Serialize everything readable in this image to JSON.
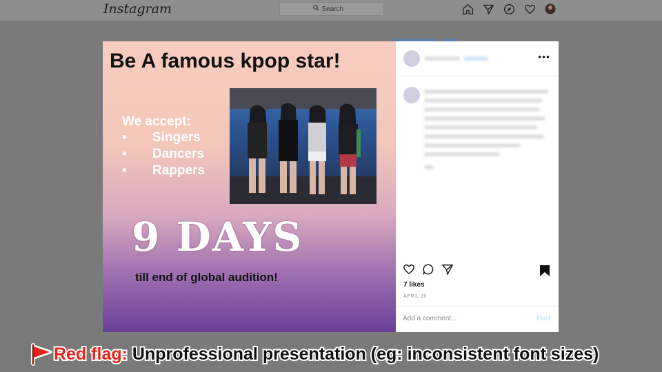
{
  "app": {
    "logo": "Instagram"
  },
  "search": {
    "placeholder": "Search",
    "icon": "search-icon"
  },
  "nav": {
    "icons": [
      "home-icon",
      "direct-icon",
      "explore-icon",
      "heart-icon",
      "profile-avatar"
    ]
  },
  "post": {
    "title": "Be A famous kpop star!",
    "accept_heading": "We accept:",
    "accept_items": [
      "Singers",
      "Dancers",
      "Rappers"
    ],
    "bullet": "•",
    "days": "9 DAYS",
    "until": "till end of global  audition!"
  },
  "sidebar": {
    "more": "•••",
    "likes": "7 likes",
    "date": "APRIL 26",
    "comment_placeholder": "Add a comment...",
    "post_label": "Post"
  },
  "caption": {
    "flag_label": "Red flag:",
    "message": "Unprofessional presentation (eg: inconsistent font sizes)"
  },
  "colors": {
    "flag_red": "#e8231b",
    "post_link": "#b2dffc",
    "gradient_top": "#f8cdbf",
    "gradient_bottom": "#6a3f98"
  }
}
